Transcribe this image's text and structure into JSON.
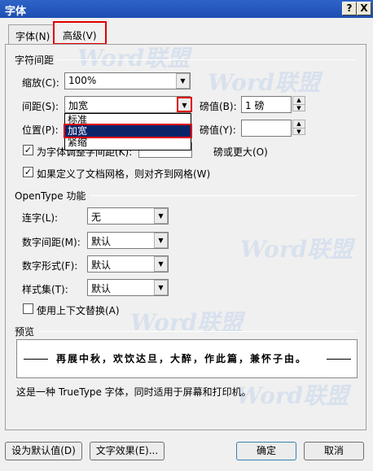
{
  "window": {
    "title": "字体",
    "help_btn": "?",
    "close_btn": "X"
  },
  "tabs": [
    {
      "label": "字体(N)"
    },
    {
      "label": "高级(V)"
    }
  ],
  "spacing": {
    "section": "字符间距",
    "scale_label": "缩放(C):",
    "scale_value": "100%",
    "spacing_label": "间距(S):",
    "spacing_value": "加宽",
    "spacing_by_label": "磅值(B):",
    "spacing_by_value": "1 磅",
    "dropdown_items": [
      "标准",
      "加宽",
      "紧缩"
    ],
    "position_label": "位置(P):",
    "position_by_label": "磅值(Y):",
    "kerning_label": "为字体调整字间距(K):",
    "kerning_suffix": "磅或更大(O)",
    "grid_label": "如果定义了文档网格，则对齐到网格(W)"
  },
  "opentype": {
    "section": "OpenType 功能",
    "ligatures_label": "连字(L):",
    "ligatures_value": "无",
    "num_spacing_label": "数字间距(M):",
    "num_spacing_value": "默认",
    "num_forms_label": "数字形式(F):",
    "num_forms_value": "默认",
    "stylistic_label": "样式集(T):",
    "stylistic_value": "默认",
    "contextual_label": "使用上下文替换(A)"
  },
  "preview": {
    "section": "预览",
    "sample": "再展中秋，欢饮达旦，大醉，作此篇，兼怀子由。",
    "note": "这是一种 TrueType 字体，同时适用于屏幕和打印机。"
  },
  "buttons": {
    "default": "设为默认值(D)",
    "effects": "文字效果(E)...",
    "ok": "确定",
    "cancel": "取消"
  },
  "watermark": "Word联盟"
}
